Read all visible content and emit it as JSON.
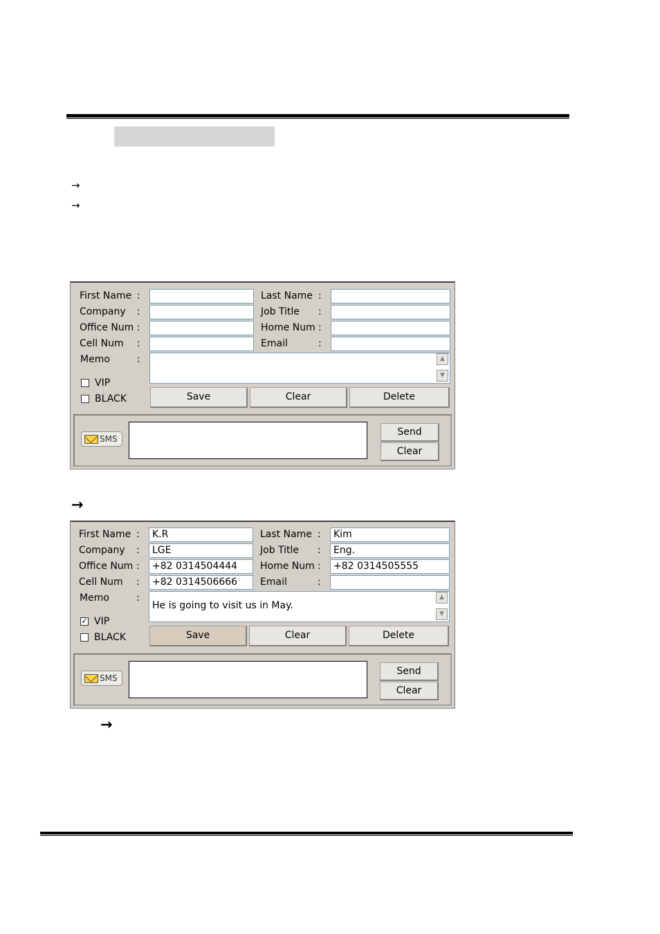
{
  "labels": {
    "first_name": "First Name",
    "last_name": "Last Name",
    "company": "Company",
    "job_title": "Job Title",
    "office_num": "Office Num",
    "home_num": "Home Num",
    "cell_num": "Cell Num",
    "email": "Email",
    "memo": "Memo",
    "vip": "VIP",
    "black": "BLACK",
    "colon": ":"
  },
  "buttons": {
    "save": "Save",
    "clear": "Clear",
    "delete": "Delete",
    "send": "Send",
    "sms_clear": "Clear"
  },
  "sms_badge": "SMS",
  "arrow": "→",
  "arrow_bold": "→",
  "panel_empty": {
    "first_name": "",
    "last_name": "",
    "company": "",
    "job_title": "",
    "office_num": "",
    "home_num": "",
    "cell_num": "",
    "email": "",
    "memo": "",
    "vip_checked": false,
    "black_checked": false
  },
  "panel_filled": {
    "first_name": "K.R",
    "last_name": "Kim",
    "company": "LGE",
    "job_title": "Eng.",
    "office_num": "+82 0314504444",
    "home_num": "+82 0314505555",
    "cell_num": "+82 0314506666",
    "email": "",
    "memo": "He is going to visit us in May.",
    "vip_checked": true,
    "vip_mark": "✓",
    "black_checked": false
  }
}
